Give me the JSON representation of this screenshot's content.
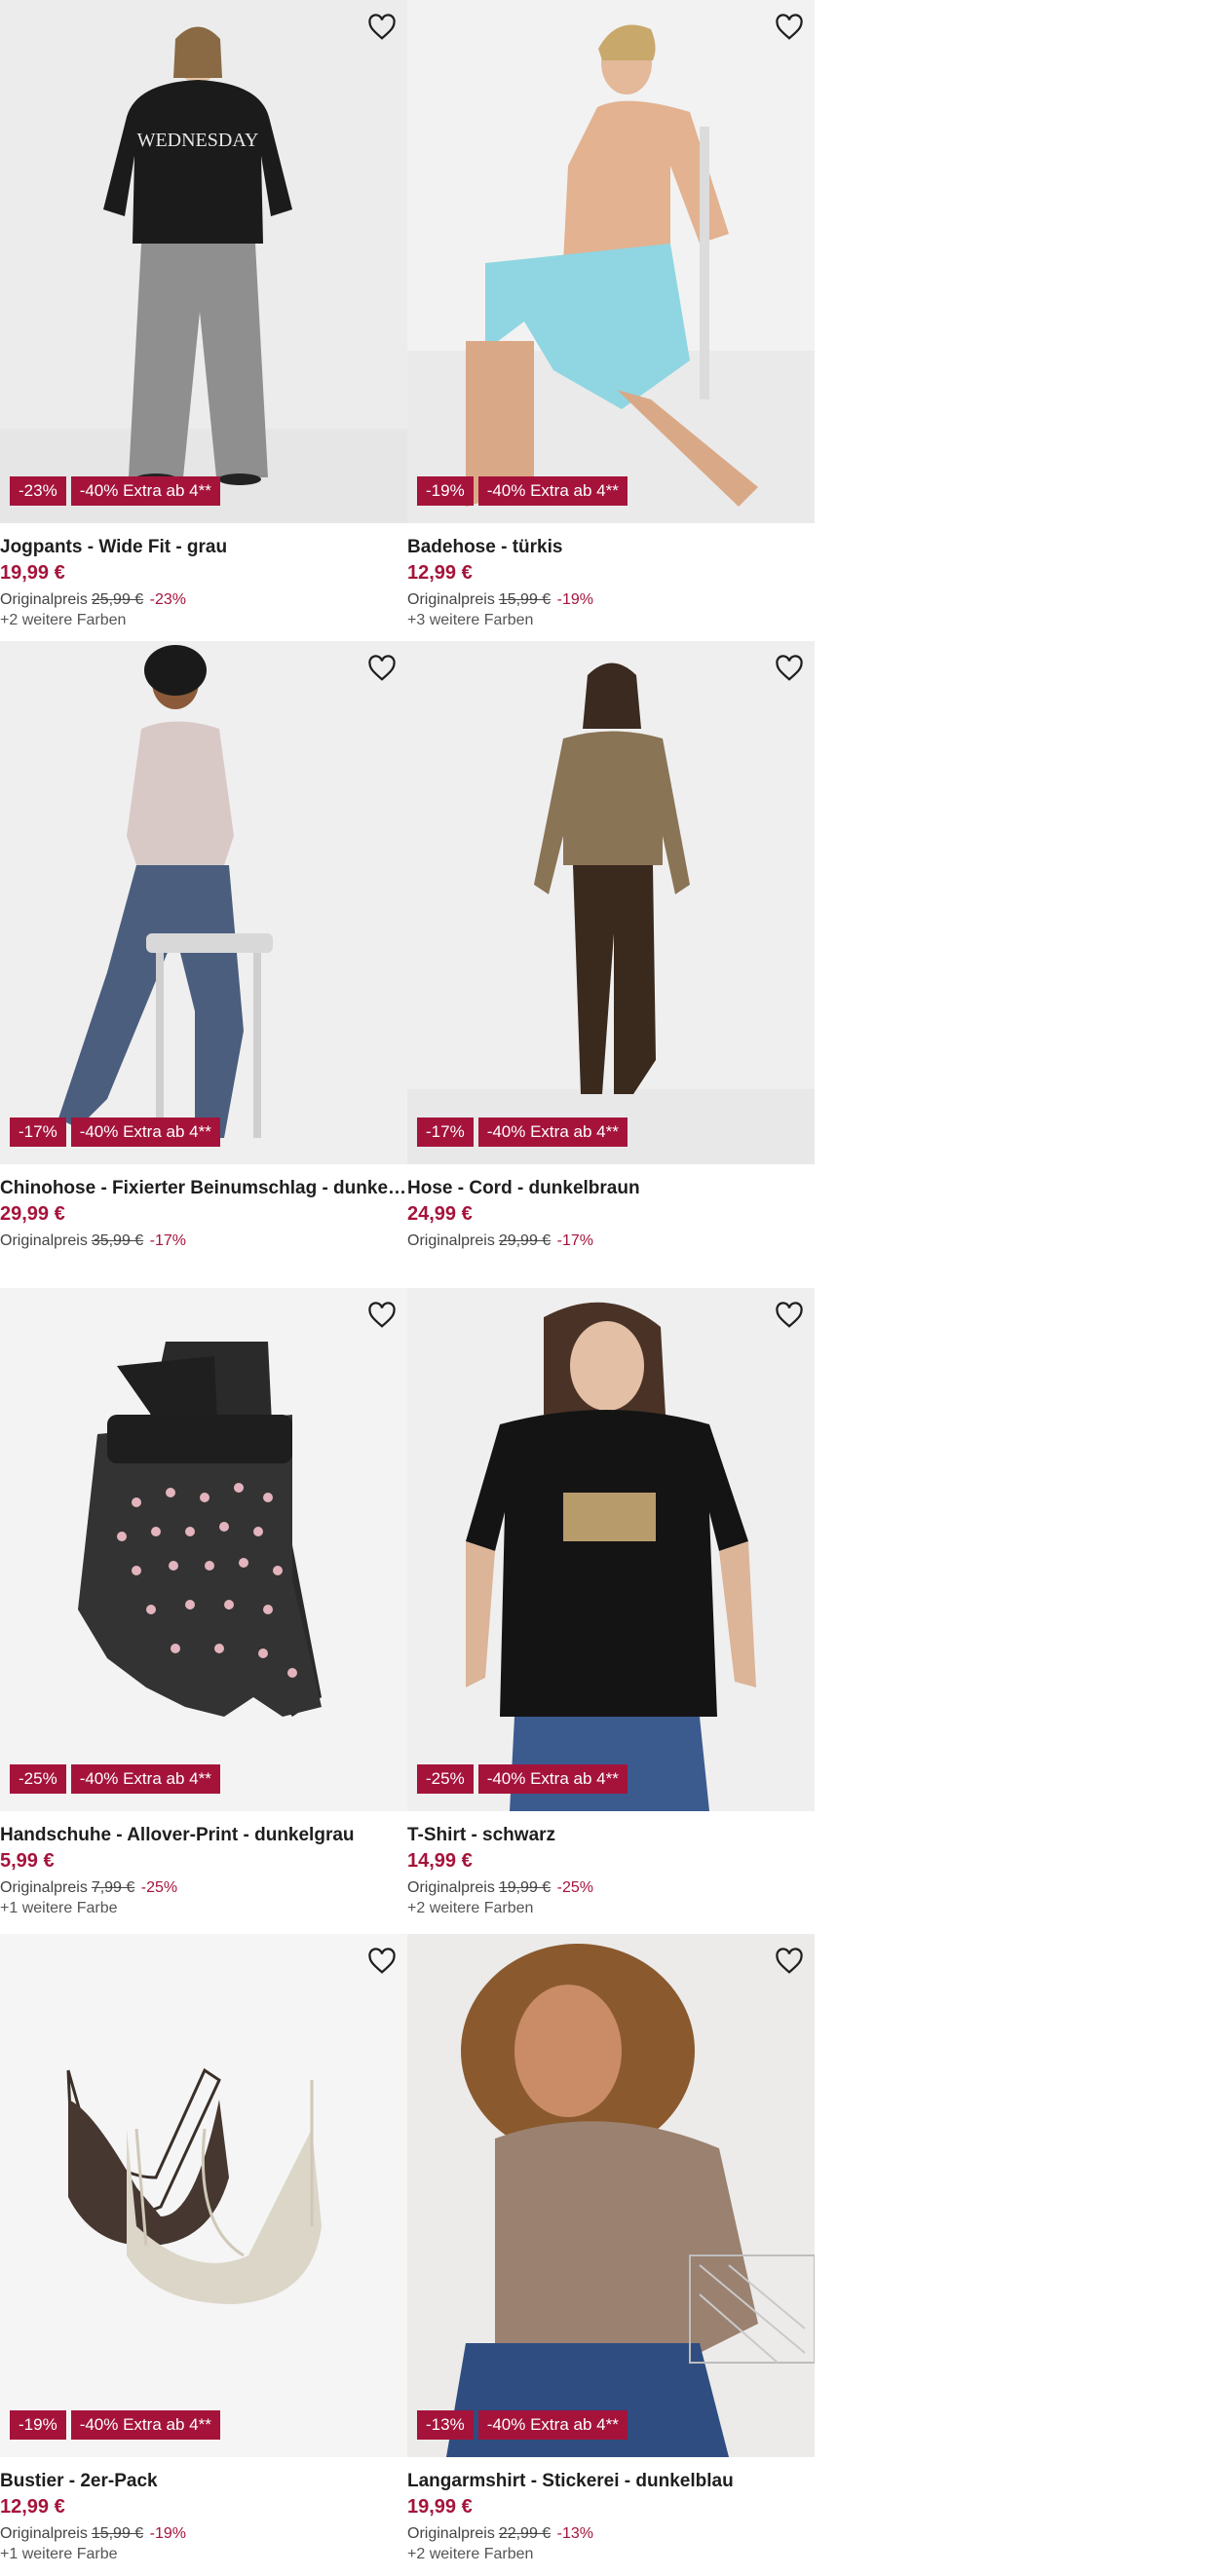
{
  "colors": {
    "accent": "#a5133b",
    "text": "#1e1e1e",
    "image_bg": "#f1f1f1"
  },
  "favorite_icon": "heart-outline-icon",
  "products": [
    {
      "name": "Jogpants - Wide Fit - grau",
      "price": "19,99 €",
      "orig_label": "Originalpreis",
      "orig_price": "25,99 €",
      "orig_pct": "-23%",
      "colors": "+2 weitere Farben",
      "badges": [
        "-23%",
        "-40% Extra ab 4**"
      ]
    },
    {
      "name": "Badehose - türkis",
      "price": "12,99 €",
      "orig_label": "Originalpreis",
      "orig_price": "15,99 €",
      "orig_pct": "-19%",
      "colors": "+3 weitere Farben",
      "badges": [
        "-19%",
        "-40% Extra ab 4**"
      ]
    },
    {
      "name": "Chinohose - Fixierter Beinumschlag - dunkelgrau",
      "price": "29,99 €",
      "orig_label": "Originalpreis",
      "orig_price": "35,99 €",
      "orig_pct": "-17%",
      "colors": "",
      "badges": [
        "-17%",
        "-40% Extra ab 4**"
      ]
    },
    {
      "name": "Hose - Cord - dunkelbraun",
      "price": "24,99 €",
      "orig_label": "Originalpreis",
      "orig_price": "29,99 €",
      "orig_pct": "-17%",
      "colors": "",
      "badges": [
        "-17%",
        "-40% Extra ab 4**"
      ]
    },
    {
      "name": "Handschuhe - Allover-Print - dunkelgrau",
      "price": "5,99 €",
      "orig_label": "Originalpreis",
      "orig_price": "7,99 €",
      "orig_pct": "-25%",
      "colors": "+1 weitere Farbe",
      "badges": [
        "-25%",
        "-40% Extra ab 4**"
      ]
    },
    {
      "name": "T-Shirt - schwarz",
      "price": "14,99 €",
      "orig_label": "Originalpreis",
      "orig_price": "19,99 €",
      "orig_pct": "-25%",
      "colors": "+2 weitere Farben",
      "badges": [
        "-25%",
        "-40% Extra ab 4**"
      ]
    },
    {
      "name": "Bustier - 2er-Pack",
      "price": "12,99 €",
      "orig_label": "Originalpreis",
      "orig_price": "15,99 €",
      "orig_pct": "-19%",
      "colors": "+1 weitere Farbe",
      "badges": [
        "-19%",
        "-40% Extra ab 4**"
      ]
    },
    {
      "name": "Langarmshirt - Stickerei - dunkelblau",
      "price": "19,99 €",
      "orig_label": "Originalpreis",
      "orig_price": "22,99 €",
      "orig_pct": "-13%",
      "colors": "+2 weitere Farben",
      "badges": [
        "-13%",
        "-40% Extra ab 4**"
      ]
    }
  ]
}
